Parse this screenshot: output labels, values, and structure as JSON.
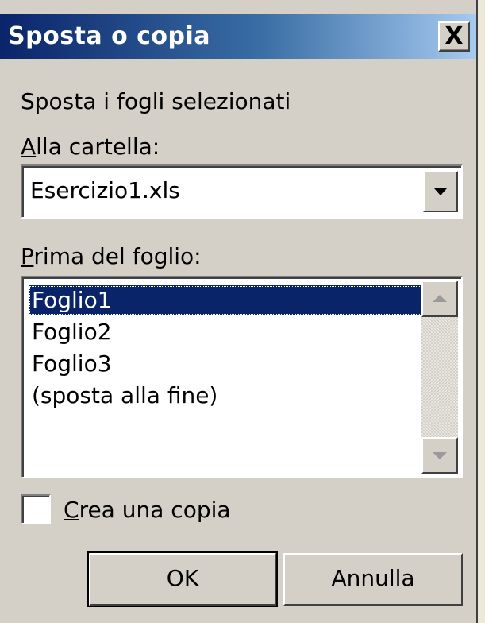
{
  "dialog": {
    "title": "Sposta o copia",
    "close_glyph": "X",
    "heading": "Sposta i fogli selezionati",
    "folder_label_ul": "A",
    "folder_label_rest": "lla cartella:",
    "folder_value": "Esercizio1.xls",
    "before_label_ul": "P",
    "before_label_rest": "rima del foglio:",
    "sheets": [
      {
        "label": "Foglio1",
        "selected": true
      },
      {
        "label": "Foglio2",
        "selected": false
      },
      {
        "label": "Foglio3",
        "selected": false
      },
      {
        "label": "(sposta alla fine)",
        "selected": false
      }
    ],
    "copy_label_ul": "C",
    "copy_label_rest": "rea una copia",
    "copy_checked": false,
    "ok_label": "OK",
    "cancel_label": "Annulla"
  },
  "icons": {
    "combo_arrow": "triangle-down",
    "scroll_up": "triangle-up",
    "scroll_down": "triangle-down"
  },
  "colors": {
    "title_bar_start": "#0a246a",
    "title_bar_end": "#a6caf0",
    "face": "#d4d0c8",
    "selection": "#0a246a"
  }
}
